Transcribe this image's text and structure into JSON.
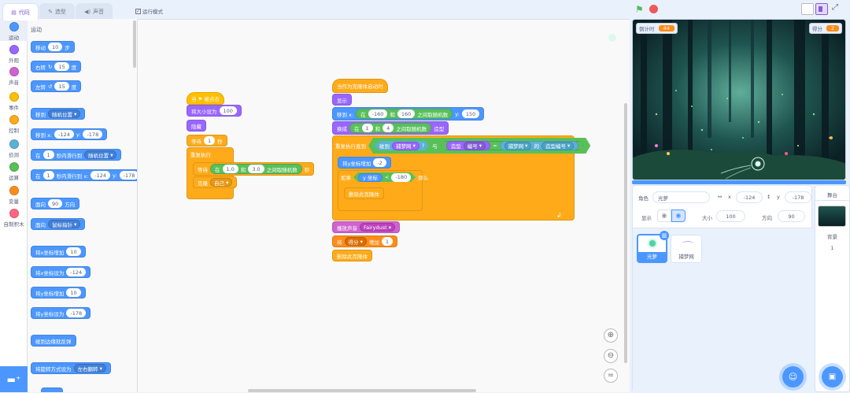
{
  "tabs": {
    "code": "代码",
    "costumes": "造型",
    "sounds": "声音"
  },
  "turbo": {
    "label": "运行模式"
  },
  "categories": [
    {
      "label": "运动",
      "color": "#4c97ff"
    },
    {
      "label": "外观",
      "color": "#9966ff"
    },
    {
      "label": "声音",
      "color": "#cf63cf"
    },
    {
      "label": "事件",
      "color": "#ffbf00"
    },
    {
      "label": "控制",
      "color": "#ffab19"
    },
    {
      "label": "侦测",
      "color": "#5cb1d6"
    },
    {
      "label": "运算",
      "color": "#59c059"
    },
    {
      "label": "变量",
      "color": "#ff8c1a"
    },
    {
      "label": "自制积木",
      "color": "#ff6680"
    }
  ],
  "palette": {
    "heading": "运动",
    "move": {
      "a": "移动",
      "v": "10",
      "b": "步"
    },
    "turn_right": {
      "a": "右转",
      "v": "15",
      "b": "度"
    },
    "turn_left": {
      "a": "左转",
      "v": "15",
      "b": "度"
    },
    "goto": {
      "a": "移到",
      "d": "随机位置"
    },
    "goto_xy": {
      "a": "移到 x:",
      "x": "-124",
      "b": "y:",
      "y": "-178"
    },
    "glide": {
      "a": "在",
      "v": "1",
      "b": "秒内滑行到",
      "d": "随机位置"
    },
    "glide_xy": {
      "a": "在",
      "v": "1",
      "b": "秒内滑行到 x:",
      "x": "-124",
      "c": "y:",
      "y": "-178"
    },
    "point": {
      "a": "面向",
      "v": "90",
      "b": "方向"
    },
    "point_to": {
      "a": "面向",
      "d": "鼠标指针"
    },
    "change_x": {
      "a": "将x坐标增加",
      "v": "10"
    },
    "set_x": {
      "a": "将x坐标设为",
      "v": "-124"
    },
    "change_y": {
      "a": "将y坐标增加",
      "v": "10"
    },
    "set_y": {
      "a": "将y坐标设为",
      "v": "-178"
    },
    "bounce": {
      "a": "碰到边缘就反弹"
    },
    "rotation": {
      "a": "将旋转方式设为",
      "d": "左右翻转"
    }
  },
  "script1": {
    "hat": "当 ⚑ 被点击",
    "size": {
      "a": "将大小设为",
      "v": "100"
    },
    "hide": "隐藏",
    "wait": {
      "a": "等待",
      "v": "1",
      "b": "秒"
    },
    "forever": "重复执行",
    "wait_rand": {
      "a": "等待",
      "op_a": "在",
      "v1": "1.0",
      "op_b": "和",
      "v2": "3.0",
      "op_c": "之间取随机数",
      "b": "秒"
    },
    "clone": {
      "a": "克隆",
      "d": "自己"
    }
  },
  "script2": {
    "hat": "当作为克隆体启动时",
    "show": "显示",
    "goto": {
      "a": "移到 x:",
      "op_a": "在",
      "v1": "-160",
      "op_b": "和",
      "v2": "160",
      "op_c": "之间取随机数",
      "b": "y:",
      "y": "150"
    },
    "costume": {
      "a": "换成",
      "op_a": "在",
      "v1": "1",
      "op_b": "和",
      "v2": "4",
      "op_c": "之间取随机数",
      "b": "造型"
    },
    "repeat": {
      "a": "重复执行直到",
      "c1": "碰到",
      "d1": "捕梦网",
      "c2": "?",
      "c3": "与",
      "c4": "造型",
      "d2": "编号",
      "c5": "=",
      "d3": "捕梦网",
      "c6": "的",
      "d4": "造型编号"
    },
    "change_y": {
      "a": "将y坐标增加",
      "v": "-2"
    },
    "if": {
      "a": "如果",
      "c1": "y 坐标",
      "c2": "<",
      "v": "-180",
      "b": "那么"
    },
    "delete_inner": "删除此克隆体",
    "sound": {
      "a": "播放声音",
      "d": "Fairydust"
    },
    "var": {
      "a": "将",
      "d": "得分",
      "b": "增加",
      "v": "1"
    },
    "delete": "删除此克隆体"
  },
  "stage": {
    "timer": {
      "label": "倒计时",
      "value": "44"
    },
    "score": {
      "label": "得分",
      "value": "2"
    }
  },
  "sprite": {
    "name_label": "角色",
    "name": "光萝",
    "x_label": "x",
    "x": "-124",
    "y_label": "y",
    "y": "-178",
    "show_label": "显示",
    "size_label": "大小",
    "size": "100",
    "dir_label": "方向",
    "dir": "90"
  },
  "sprites": [
    {
      "name": "光萝"
    },
    {
      "name": "捕梦网"
    }
  ],
  "stage_panel": {
    "title": "舞台",
    "bg_label": "背景",
    "bg_count": "1"
  },
  "colors": {
    "accent": "#855cd6",
    "motion": "#4c97ff",
    "selected": "#4c97ff"
  }
}
